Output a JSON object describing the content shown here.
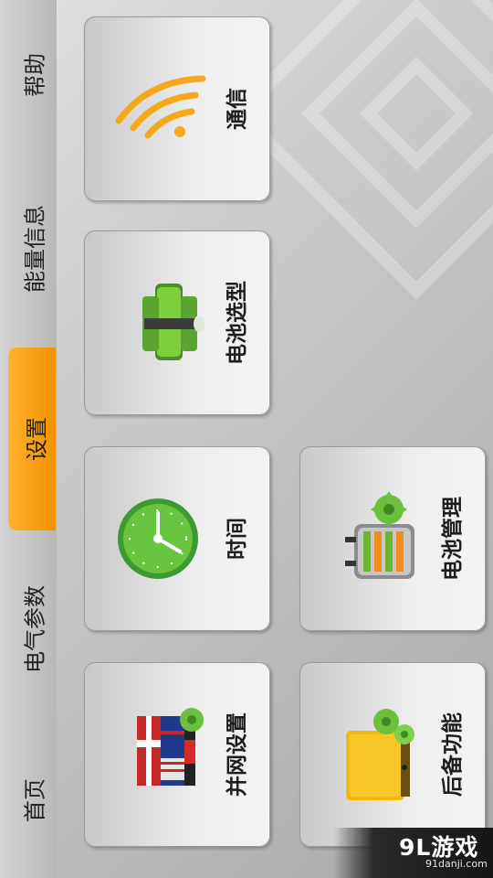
{
  "nav": {
    "items": [
      {
        "label": "首页",
        "active": false
      },
      {
        "label": "电气参数",
        "active": false
      },
      {
        "label": "设置",
        "active": true
      },
      {
        "label": "能量信息",
        "active": false
      },
      {
        "label": "帮助",
        "active": false
      }
    ],
    "active_color": "#f39200"
  },
  "tiles": [
    {
      "label": "通信",
      "icon": "wifi-icon"
    },
    {
      "label": "电池选型",
      "icon": "battery-pack-icon"
    },
    {
      "label": "时间",
      "icon": "clock-icon"
    },
    {
      "label": "电池管理",
      "icon": "battery-gear-icon"
    },
    {
      "label": "并网设置",
      "icon": "flags-gear-icon"
    },
    {
      "label": "后备功能",
      "icon": "backup-box-gear-icon"
    }
  ],
  "watermark": {
    "main": "9L游戏",
    "sub": "91danji.com"
  }
}
